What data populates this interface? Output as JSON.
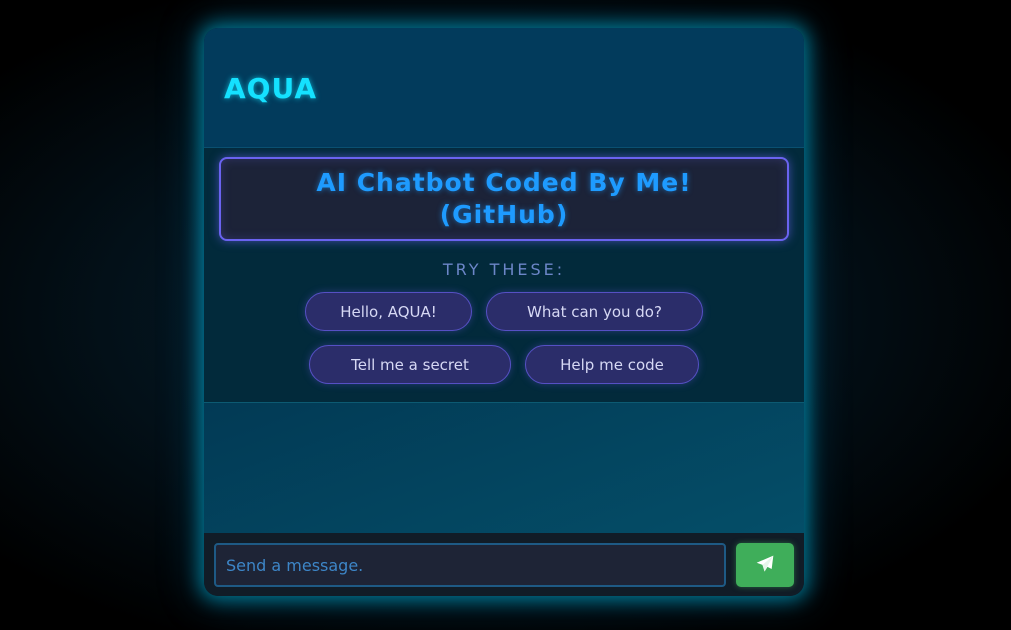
{
  "header": {
    "title": "AQUA"
  },
  "welcome": {
    "banner_line1": "AI Chatbot Coded By Me!",
    "banner_line2": "(GitHub)",
    "try_label": "TRY THESE:",
    "suggestions": [
      "Hello, AQUA!",
      "What can you do?",
      "Tell me a secret",
      "Help me code"
    ]
  },
  "composer": {
    "placeholder": "Send a message.",
    "send_icon": "paper-plane-icon"
  },
  "colors": {
    "accent": "#14e1ff",
    "banner_text": "#1e9bff",
    "chip_border": "#5650c4",
    "send_button": "#3fae5a"
  }
}
